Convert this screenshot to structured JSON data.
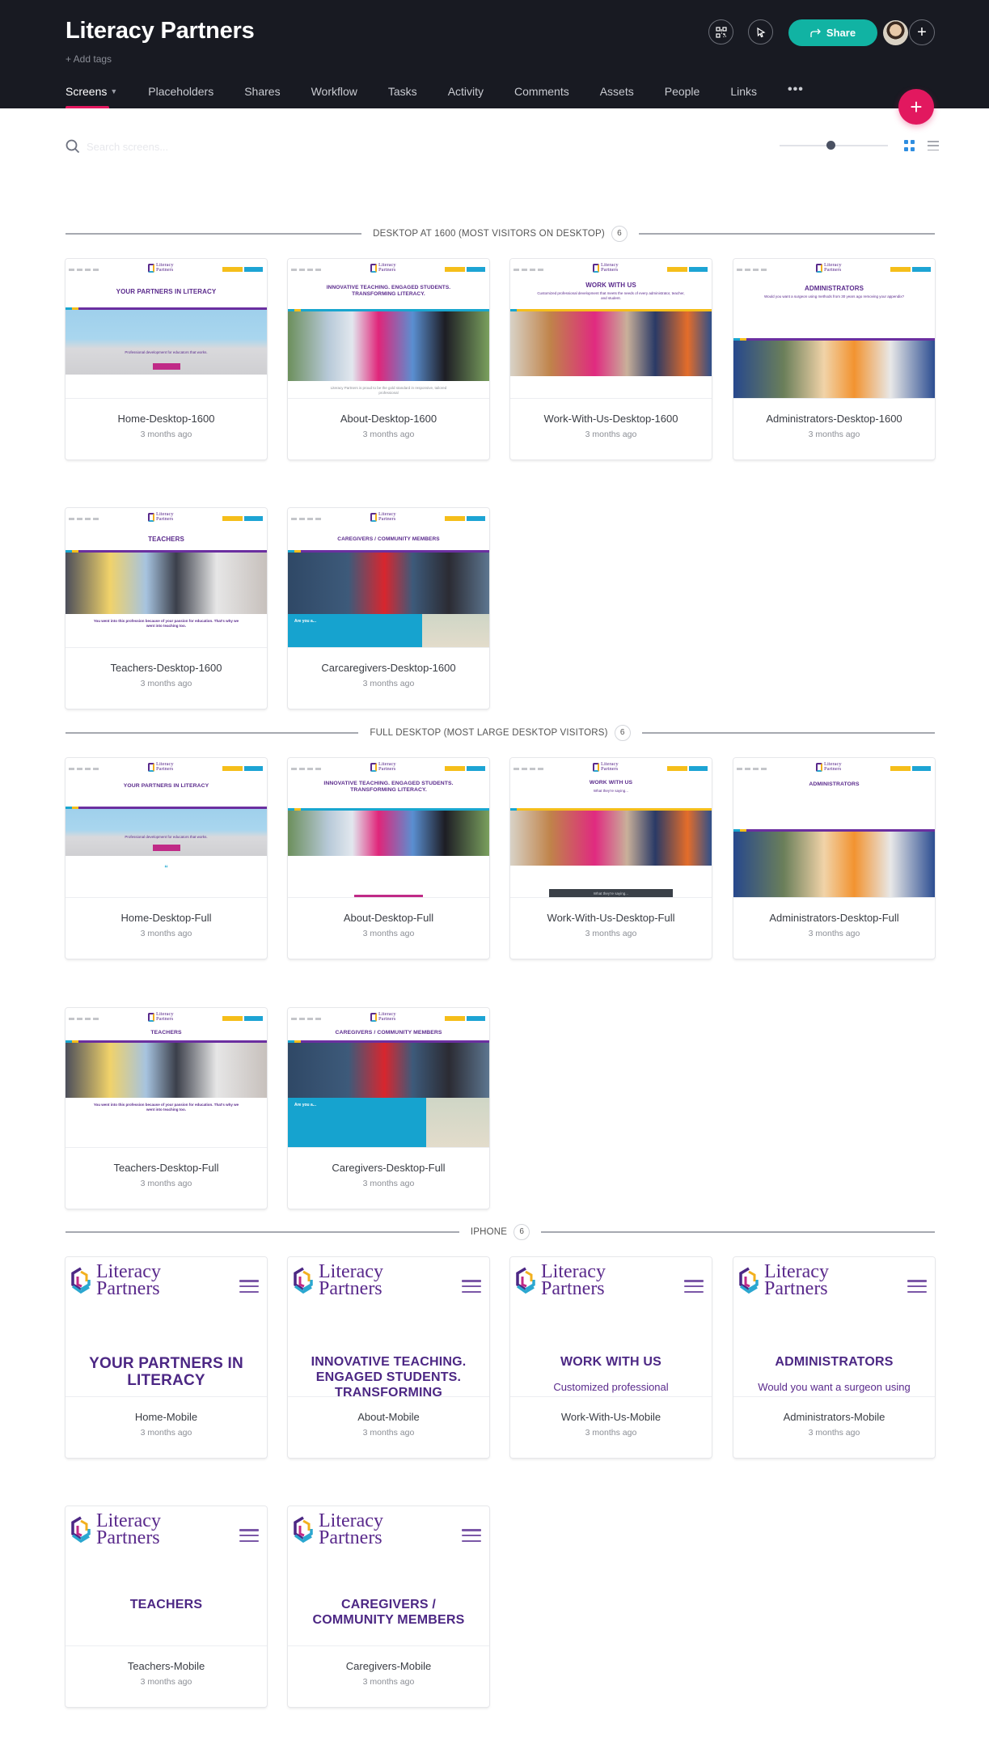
{
  "project": {
    "title": "Literacy Partners",
    "add_tags_label": "+ Add tags"
  },
  "nav": {
    "tabs": [
      {
        "label": "Screens",
        "active": true,
        "has_caret": true
      },
      {
        "label": "Placeholders"
      },
      {
        "label": "Shares"
      },
      {
        "label": "Workflow"
      },
      {
        "label": "Tasks"
      },
      {
        "label": "Activity"
      },
      {
        "label": "Comments"
      },
      {
        "label": "Assets"
      },
      {
        "label": "People"
      },
      {
        "label": "Links"
      }
    ],
    "more_label": "•••"
  },
  "header_actions": {
    "share_label": "Share",
    "qr_icon": "qr-code-icon",
    "cursor_icon": "pointer-cursor-icon",
    "add_person_label": "+",
    "fab_label": "+"
  },
  "toolbar": {
    "search_placeholder": "Search screens...",
    "zoom_level_percent": 47,
    "view_mode": "grid"
  },
  "colors": {
    "header_bg": "#181a22",
    "accent_pink": "#e2185f",
    "share_teal": "#11b3a3",
    "brand_purple": "#5a2a8c",
    "grid_active_blue": "#2e8de0"
  },
  "sections": [
    {
      "title": "DESKTOP AT 1600 (MOST VISITORS ON DESKTOP)",
      "count": "6",
      "screens": [
        {
          "name": "Home-Desktop-1600",
          "time": "3 months ago",
          "hero": "YOUR PARTNERS IN LITERACY",
          "sub": "Professional development for educators that works."
        },
        {
          "name": "About-Desktop-1600",
          "time": "3 months ago",
          "hero": "INNOVATIVE TEACHING. ENGAGED STUDENTS. TRANSFORMING LITERACY.",
          "sub": "Literacy Partners is proud to be the gold standard in responsive, tailored professional"
        },
        {
          "name": "Work-With-Us-Desktop-1600",
          "time": "3 months ago",
          "hero": "WORK WITH US",
          "sub": "Customized professional development that meets the needs of every administrator, teacher, and student."
        },
        {
          "name": "Administrators-Desktop-1600",
          "time": "3 months ago",
          "hero": "ADMINISTRATORS",
          "sub": "Would you want a surgeon using methods from 30 years ago removing your appendix?"
        },
        {
          "name": "Teachers-Desktop-1600",
          "time": "3 months ago",
          "hero": "TEACHERS",
          "sub": "You went into this profession because of your passion for education. That's why we went into teaching too."
        },
        {
          "name": "Carcaregivers-Desktop-1600",
          "time": "3 months ago",
          "hero": "CAREGIVERS / COMMUNITY MEMBERS",
          "sub": "Are you a..."
        }
      ]
    },
    {
      "title": "FULL DESKTOP (MOST LARGE DESKTOP VISITORS)",
      "count": "6",
      "screens": [
        {
          "name": "Home-Desktop-Full",
          "time": "3 months ago",
          "hero": "YOUR PARTNERS IN LITERACY",
          "sub": "Professional development for educators that works."
        },
        {
          "name": "About-Desktop-Full",
          "time": "3 months ago",
          "hero": "INNOVATIVE TEACHING. ENGAGED STUDENTS. TRANSFORMING LITERACY.",
          "sub": ""
        },
        {
          "name": "Work-With-Us-Desktop-Full",
          "time": "3 months ago",
          "hero": "WORK WITH US",
          "sub": "What they're saying..."
        },
        {
          "name": "Administrators-Desktop-Full",
          "time": "3 months ago",
          "hero": "ADMINISTRATORS",
          "sub": ""
        },
        {
          "name": "Teachers-Desktop-Full",
          "time": "3 months ago",
          "hero": "TEACHERS",
          "sub": "You went into this profession because of your passion for education. That's why we went into teaching too."
        },
        {
          "name": "Caregivers-Desktop-Full",
          "time": "3 months ago",
          "hero": "CAREGIVERS / COMMUNITY MEMBERS",
          "sub": "Are you a..."
        }
      ]
    },
    {
      "title": "IPHONE",
      "count": "6",
      "screens": [
        {
          "name": "Home-Mobile",
          "time": "3 months ago",
          "logo": "Literacy Partners",
          "hero": "YOUR PARTNERS IN LITERACY",
          "sub": ""
        },
        {
          "name": "About-Mobile",
          "time": "3 months ago",
          "logo": "Literacy Partners",
          "hero": "INNOVATIVE TEACHING. ENGAGED STUDENTS. TRANSFORMING",
          "sub": ""
        },
        {
          "name": "Work-With-Us-Mobile",
          "time": "3 months ago",
          "logo": "Literacy Partners",
          "hero": "WORK WITH US",
          "sub": "Customized professional"
        },
        {
          "name": "Administrators-Mobile",
          "time": "3 months ago",
          "logo": "Literacy Partners",
          "hero": "ADMINISTRATORS",
          "sub": "Would you want a surgeon using"
        },
        {
          "name": "Teachers-Mobile",
          "time": "3 months ago",
          "logo": "Literacy Partners",
          "hero": "TEACHERS",
          "sub": ""
        },
        {
          "name": "Caregivers-Mobile",
          "time": "3 months ago",
          "logo": "Literacy Partners",
          "hero": "CAREGIVERS / COMMUNITY MEMBERS",
          "sub": ""
        }
      ]
    }
  ]
}
